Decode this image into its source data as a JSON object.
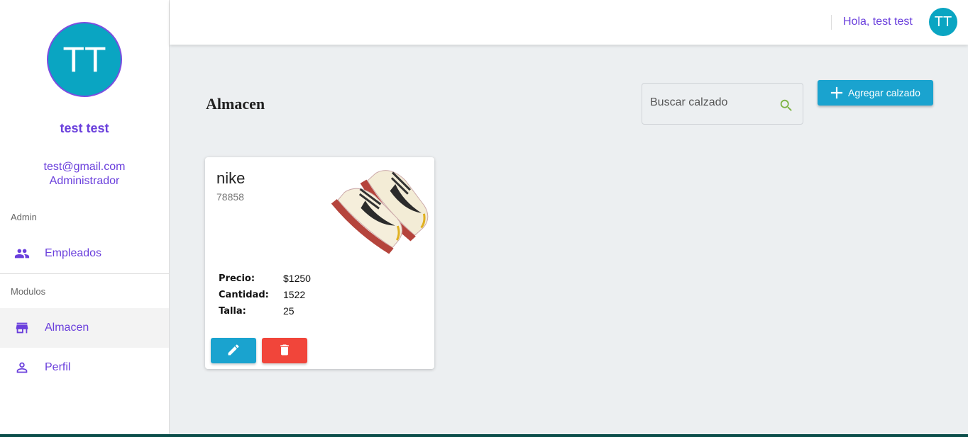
{
  "sidebar": {
    "avatar_initials": "TT",
    "user_name": "test test",
    "email": "test@gmail.com",
    "role": "Administrador",
    "sections": [
      {
        "label": "Admin"
      },
      {
        "label": "Modulos"
      }
    ],
    "items": [
      {
        "label": "Empleados",
        "icon": "people-icon"
      },
      {
        "label": "Almacen",
        "icon": "store-icon",
        "active": true
      },
      {
        "label": "Perfil",
        "icon": "person-icon"
      }
    ]
  },
  "topbar": {
    "greeting": "Hola, test test",
    "avatar_initials": "TT"
  },
  "main": {
    "title": "Almacen",
    "search": {
      "placeholder": "Buscar calzado",
      "value": ""
    },
    "add_button": "Agregar calzado"
  },
  "products": [
    {
      "name": "nike",
      "code": "78858",
      "specs": [
        {
          "key": "Precio:",
          "value": "$1250"
        },
        {
          "key": "Cantidad:",
          "value": "1522"
        },
        {
          "key": "Talla:",
          "value": "25"
        }
      ]
    }
  ],
  "colors": {
    "accent": "#6a3fdc",
    "avatar": "#0aa5c2",
    "primary_button": "#1aa3cf",
    "danger_button": "#f1453a",
    "background": "#eceff1"
  }
}
